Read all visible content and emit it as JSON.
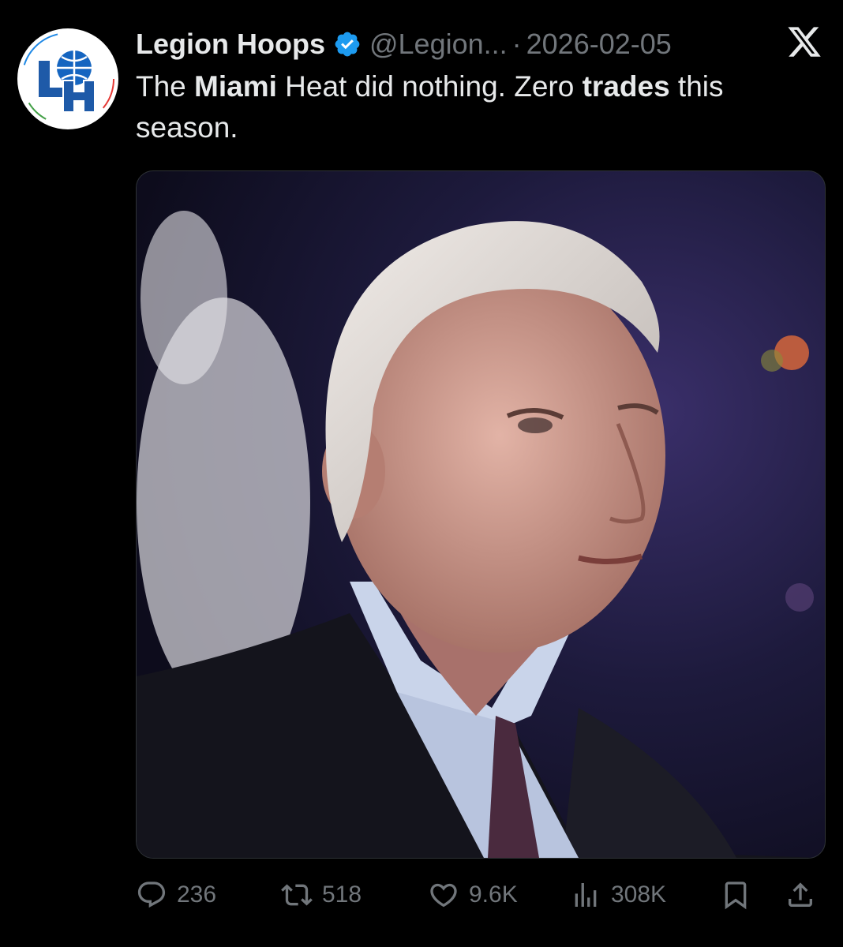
{
  "tweet": {
    "display_name": "Legion Hoops",
    "handle": "@Legion...",
    "separator": "·",
    "date": "2026-02-05",
    "text_segments": [
      {
        "text": "The ",
        "bold": false
      },
      {
        "text": "Miami",
        "bold": true
      },
      {
        "text": " Heat did nothing. Zero ",
        "bold": false
      },
      {
        "text": "trades",
        "bold": true
      },
      {
        "text": " this season.",
        "bold": false
      }
    ],
    "avatar_icon": "legion-hoops-logo",
    "verified_icon": "verified-badge-icon",
    "platform_icon": "x-logo-icon"
  },
  "metrics": {
    "replies": "236",
    "retweets": "518",
    "likes": "9.6K",
    "views": "308K"
  },
  "colors": {
    "background": "#000000",
    "text_primary": "#e7e9ea",
    "text_secondary": "#71767b",
    "verified_blue": "#1d9bf0"
  }
}
